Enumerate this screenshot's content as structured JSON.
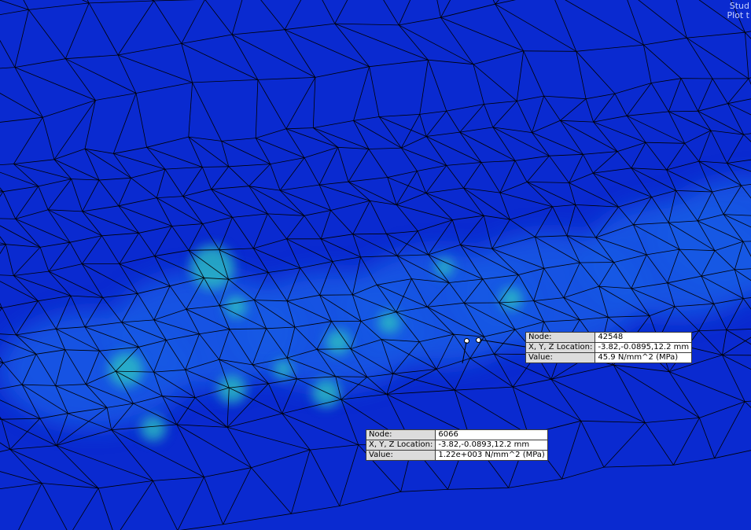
{
  "viewport": {
    "corner_text": [
      "Stud",
      "Plot t"
    ],
    "colors": {
      "background": "#0a2ad0",
      "mesh_lines": "#000000",
      "hotspot": "#35d2b6"
    }
  },
  "probes": [
    {
      "name": "probe-upper",
      "rows": [
        {
          "key": "Node:",
          "value": "42548"
        },
        {
          "key": "X, Y, Z Location:",
          "value": "-3.82,-0.0895,12.2 mm"
        },
        {
          "key": "Value:",
          "value": "45.9       N/mm^2 (MPa)"
        }
      ]
    },
    {
      "name": "probe-lower",
      "rows": [
        {
          "key": "Node:",
          "value": "6066"
        },
        {
          "key": "X, Y, Z Location:",
          "value": "-3.82,-0.0893,12.2 mm"
        },
        {
          "key": "Value:",
          "value": "1.22e+003  N/mm^2 (MPa)"
        }
      ]
    }
  ]
}
